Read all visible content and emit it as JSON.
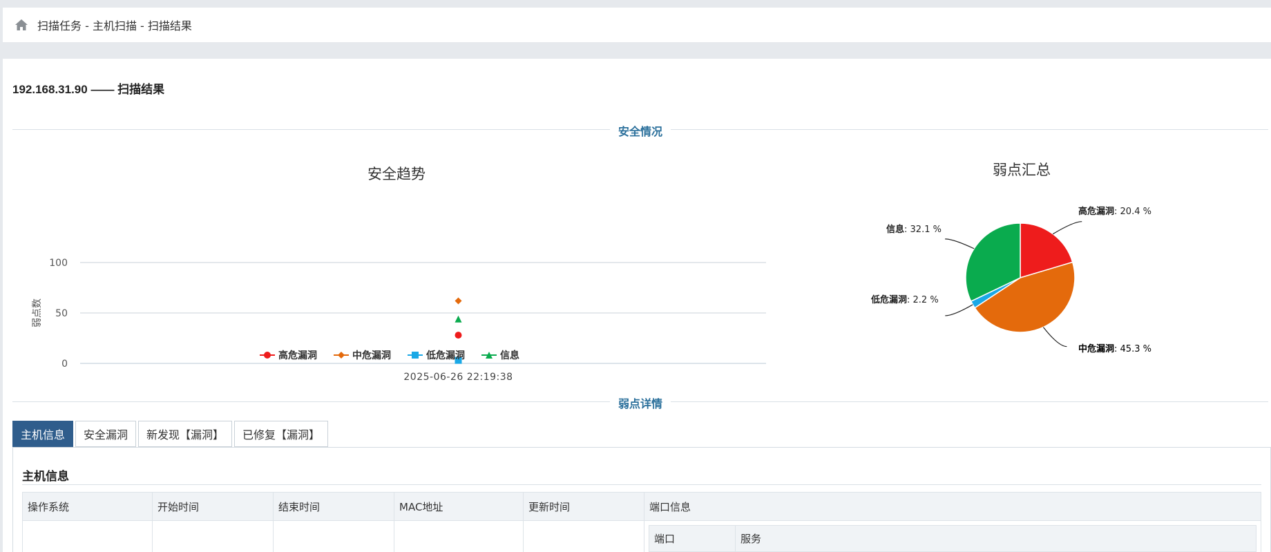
{
  "breadcrumb": "扫描任务 - 主机扫描 - 扫描结果",
  "page_title": "192.168.31.90 —— 扫描结果",
  "sections": {
    "security": "安全情况",
    "details": "弱点详情"
  },
  "trend_chart": {
    "title": "安全趋势",
    "ylabel": "弱点数",
    "ticks": [
      "100",
      "50",
      "0"
    ],
    "date": "2025-06-26 22:19:38"
  },
  "pie_chart": {
    "title": "弱点汇总",
    "labels": {
      "high": "高危漏洞",
      "high_pct": ": 20.4 %",
      "medium": "中危漏洞",
      "medium_pct": ": 45.3 %",
      "low": "低危漏洞",
      "low_pct": ": 2.2 %",
      "info": "信息",
      "info_pct": ": 32.1 %"
    }
  },
  "legend": [
    "高危漏洞",
    "中危漏洞",
    "低危漏洞",
    "信息"
  ],
  "tabs": [
    "主机信息",
    "安全漏洞",
    "新发现【漏洞】",
    "已修复【漏洞】"
  ],
  "host_info": {
    "title": "主机信息",
    "columns": [
      "操作系统",
      "开始时间",
      "结束时间",
      "MAC地址",
      "更新时间",
      "端口信息"
    ],
    "port_columns": [
      "端口",
      "服务"
    ]
  },
  "colors": {
    "high": "#ee1c1c",
    "medium": "#e46a0c",
    "low": "#1aa8e6",
    "info": "#0aab4e",
    "accent": "#2f5d8c"
  },
  "chart_data": [
    {
      "type": "scatter",
      "title": "安全趋势",
      "xlabel": "",
      "ylabel": "弱点数",
      "ylim": [
        0,
        100
      ],
      "categories": [
        "2025-06-26 22:19:38"
      ],
      "series": [
        {
          "name": "高危漏洞",
          "values": [
            28
          ]
        },
        {
          "name": "中危漏洞",
          "values": [
            62
          ]
        },
        {
          "name": "低危漏洞",
          "values": [
            3
          ]
        },
        {
          "name": "信息",
          "values": [
            44
          ]
        }
      ],
      "legend": "bottom",
      "grid": true
    },
    {
      "type": "pie",
      "title": "弱点汇总",
      "categories": [
        "高危漏洞",
        "中危漏洞",
        "低危漏洞",
        "信息"
      ],
      "values": [
        20.4,
        45.3,
        2.2,
        32.1
      ]
    }
  ]
}
